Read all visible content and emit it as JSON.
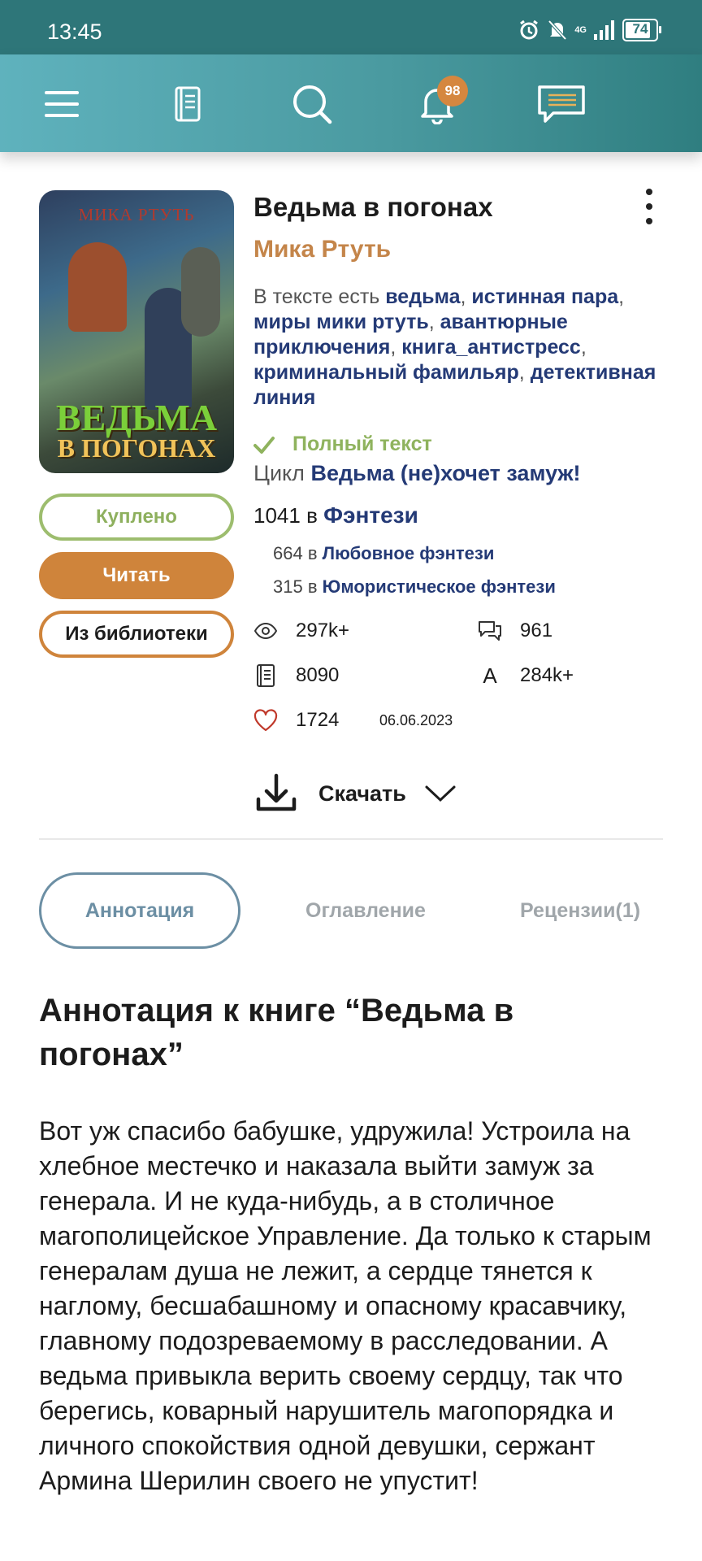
{
  "status_bar": {
    "time": "13:45",
    "network": "4G",
    "battery": "74"
  },
  "toolbar": {
    "items": [
      "menu-icon",
      "book-icon",
      "search-icon",
      "bell-icon",
      "chat-icon"
    ],
    "notifications_count": "98"
  },
  "book": {
    "cover_author": "МИКА РТУТЬ",
    "cover_title_line1": "ВЕДЬМА",
    "cover_title_line2": "В ПОГОНАХ",
    "title": "Ведьма в погонах",
    "author": "Мика Ртуть",
    "tags_prefix": "В тексте есть",
    "tags": [
      "ведьма",
      "истинная пара",
      "миры мики ртуть",
      "авантюрные приключения",
      "книга_антистресс",
      "криминальный фамильяр",
      "детективная линия"
    ],
    "status": "Полный текст",
    "cycle_label": "Цикл",
    "cycle_name": "Ведьма (не)хочет замуж!",
    "rank_main_number": "1041",
    "rank_in": "в",
    "rank_main_genre": "Фэнтези",
    "rank_sub": [
      {
        "number": "664",
        "genre": "Любовное фэнтези"
      },
      {
        "number": "315",
        "genre": "Юмористическое фэнтези"
      }
    ]
  },
  "buttons": {
    "bought": "Куплено",
    "read": "Читать",
    "from_library": "Из библиотеки"
  },
  "stats": {
    "views": "297k+",
    "comments": "961",
    "pages": "8090",
    "chars_icon_letter": "A",
    "chars": "284k+",
    "likes": "1724",
    "date": "06.06.2023"
  },
  "download": {
    "label": "Скачать"
  },
  "tabs": [
    {
      "label": "Аннотация",
      "active": true
    },
    {
      "label": "Оглавление",
      "active": false
    },
    {
      "label": "Рецензии(1)",
      "active": false
    }
  ],
  "annotation": {
    "title": "Аннотация к книге “Ведьма в погонах”",
    "text": "Вот уж спасибо бабушке, удружила! Устроила на хлебное местечко и наказала выйти замуж за генерала. И не куда-нибудь, а в столичное магополицейское Управление. Да только к старым генералам душа не лежит, а сердце тянется к наглому, бесшабашному и опасному красавчику, главному подозреваемому в расследовании. А ведьма привыкла верить своему сердцу, так что берегись, коварный нарушитель магопорядка и личного спокойствия одной девушки, сержант Армина Шерилин своего не упустит!"
  },
  "colors": {
    "status_bar": "#2e7679",
    "toolbar_start": "#5fb2bd",
    "accent_orange": "#cf843b",
    "link_blue": "#243a76",
    "green": "#8fb35e",
    "tab_active": "#6c8fa4"
  }
}
